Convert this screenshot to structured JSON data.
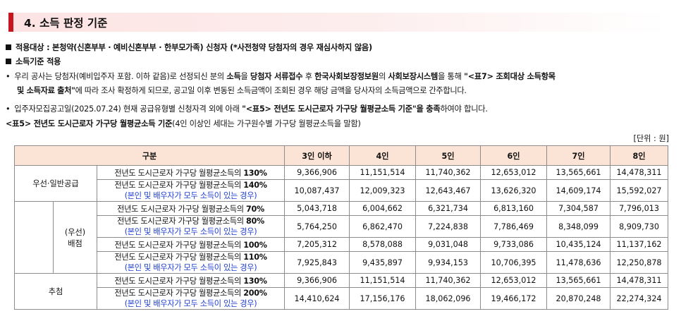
{
  "section": {
    "title": "4. 소득 판정 기준",
    "accent_color": "#c8161e"
  },
  "line_target": {
    "prefix": "적용대상 : 본청약(신혼부부 · 예비신혼부부 · 한부모가족) 신청자 (",
    "note": "*사전청약 당첨자의 경우 재심사하지 않음",
    "suffix": ")"
  },
  "line_criteria": "소득기준 적용",
  "para1": {
    "p1": "우리 공사는 당첨자(예비입주자 포함. 이하 같음)로 선정되신 분의 ",
    "b1": "소득",
    "p2": "을 ",
    "b2": "당첨자 서류접수",
    "p3": " 후 ",
    "b3": "한국사회보장정보원",
    "p4": "의 ",
    "b4": "사회보장시스템",
    "p5": "을 통해  ",
    "b5": "\"<표7> 조회대상 소득항목",
    "b6": "및 소득자료 출처\"",
    "p6": "에 따라 조사 확정하게 되므로, 공고일 이후 변동된 소득금액이 조회된 경우 해당 금액을 당사자의 소득금액으로 간주합니다."
  },
  "para2": {
    "p1": "입주자모집공고일(2025.07.24) 현재 공급유형별 신청자격 외에 아래 ",
    "b1": "\"<표5> 전년도 도시근로자 가구당 월평균소득 기준\"을 충족",
    "p2": "하여야 합니다."
  },
  "table_caption": {
    "bold": "<표5> 전년도 도시근로자 가구당 월평균소득 기준",
    "normal": "(4인 이상인 세대는 가구원수별 가구당 월평균소득을 말함)"
  },
  "unit_label": "[단위 : 원]",
  "table": {
    "header": [
      "구분",
      "3인 이하",
      "4인",
      "5인",
      "6인",
      "7인",
      "8인"
    ],
    "criterion_prefix": "전년도 도시근로자 가구당 월평균소득의 ",
    "dual_note": "(본인 및 배우자가 모두 소득이 있는 경우)",
    "groups": {
      "general": "우선·일반공급",
      "priority_line1": "(우선)",
      "priority_line2": "배점",
      "lottery": "추첨"
    },
    "rows": [
      {
        "pct": "130%",
        "values": [
          "9,366,906",
          "11,151,514",
          "11,740,362",
          "12,653,012",
          "13,565,661",
          "14,478,311"
        ]
      },
      {
        "pct": "140%",
        "values": [
          "10,087,437",
          "12,009,323",
          "12,643,467",
          "13,626,320",
          "14,609,174",
          "15,592,027"
        ]
      },
      {
        "pct": "70%",
        "values": [
          "5,043,718",
          "6,004,662",
          "6,321,734",
          "6,813,160",
          "7,304,587",
          "7,796,013"
        ]
      },
      {
        "pct": "80%",
        "values": [
          "5,764,250",
          "6,862,470",
          "7,224,838",
          "7,786,469",
          "8,348,099",
          "8,909,730"
        ]
      },
      {
        "pct": "100%",
        "values": [
          "7,205,312",
          "8,578,088",
          "9,031,048",
          "9,733,086",
          "10,435,124",
          "11,137,162"
        ]
      },
      {
        "pct": "110%",
        "values": [
          "7,925,843",
          "9,435,897",
          "9,934,153",
          "10,706,395",
          "11,478,636",
          "12,250,878"
        ]
      },
      {
        "pct": "130%",
        "values": [
          "9,366,906",
          "11,151,514",
          "11,740,362",
          "12,653,012",
          "13,565,661",
          "14,478,311"
        ]
      },
      {
        "pct": "200%",
        "values": [
          "14,410,624",
          "17,156,176",
          "18,062,096",
          "19,466,172",
          "20,870,248",
          "22,274,324"
        ]
      }
    ]
  },
  "colors": {
    "header_bg": "#fbe4d5",
    "note_text": "#1f3fcf",
    "border": "#8c8c8c"
  }
}
